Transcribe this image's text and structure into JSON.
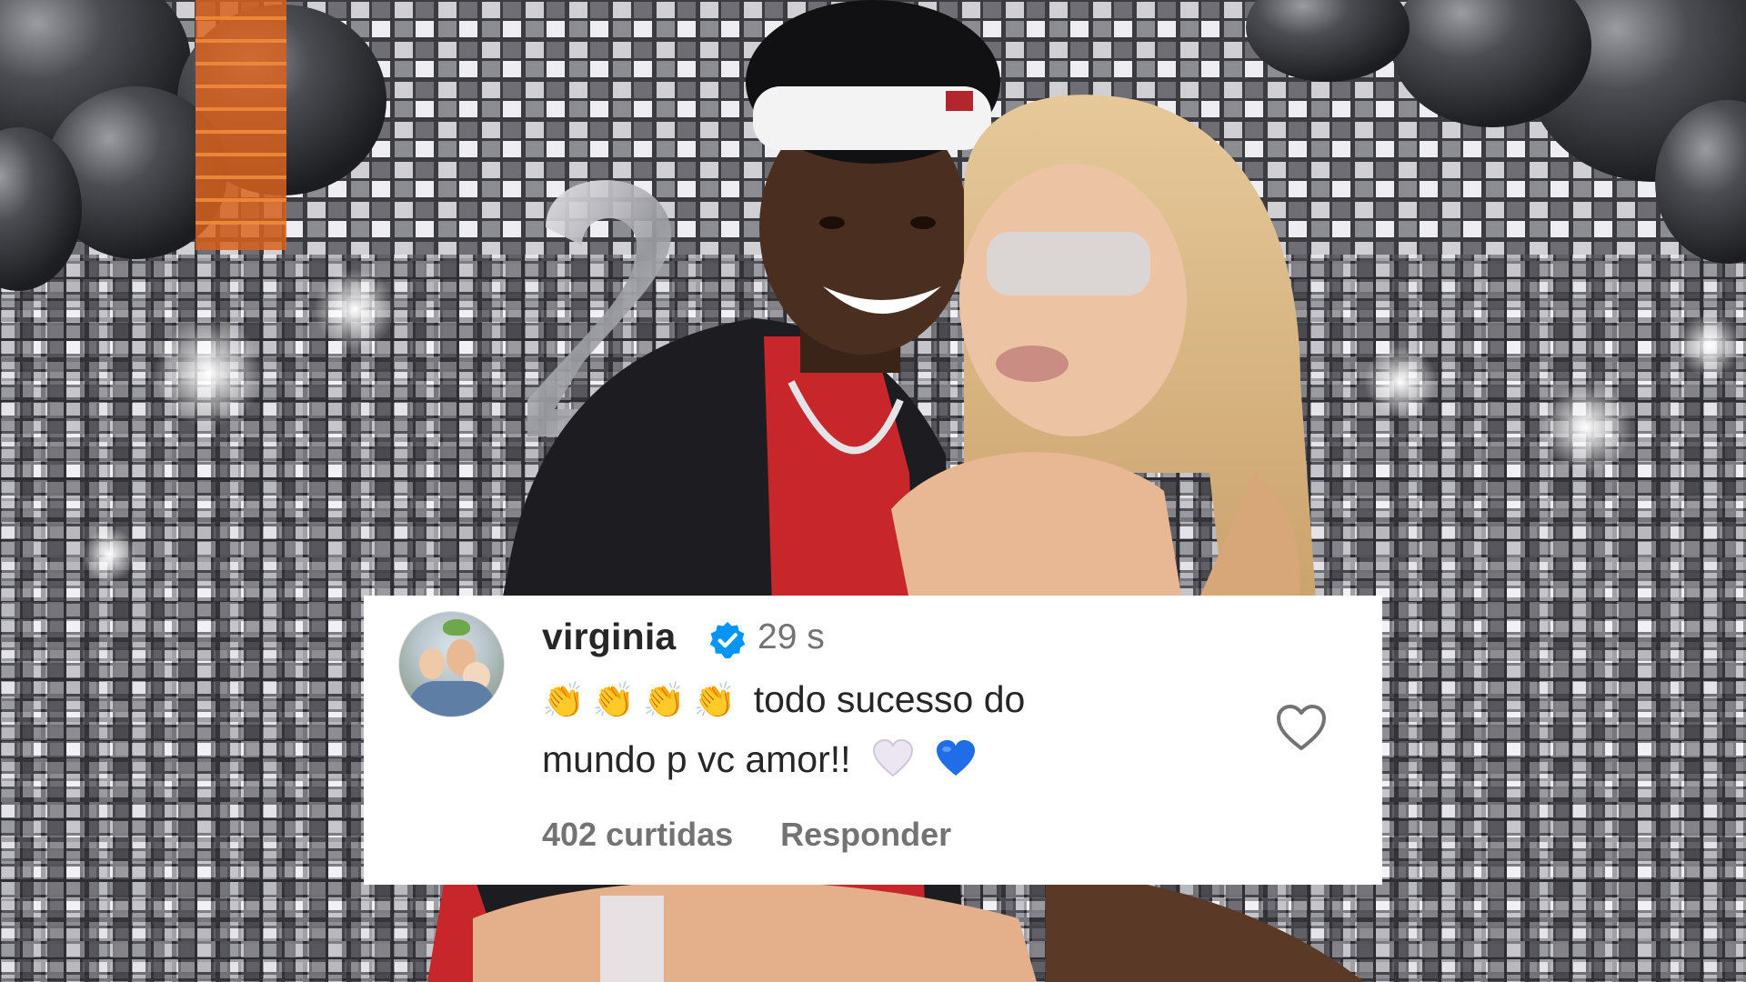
{
  "comment": {
    "username": "virginia",
    "verified_icon": "verified-badge-icon",
    "time": "29 s",
    "emojis": [
      "👏",
      "👏",
      "👏",
      "👏"
    ],
    "text_line1": "todo sucesso do",
    "text_line2": "mundo p vc amor!!",
    "trailing_emojis": [
      "white-heart-icon",
      "blue-heart-icon"
    ],
    "likes": "402 curtidas",
    "reply": "Responder",
    "like_icon": "heart-outline-icon",
    "colors": {
      "text": "#262626",
      "muted": "#737373",
      "verified": "#0095f6",
      "card": "#ffffff"
    }
  }
}
